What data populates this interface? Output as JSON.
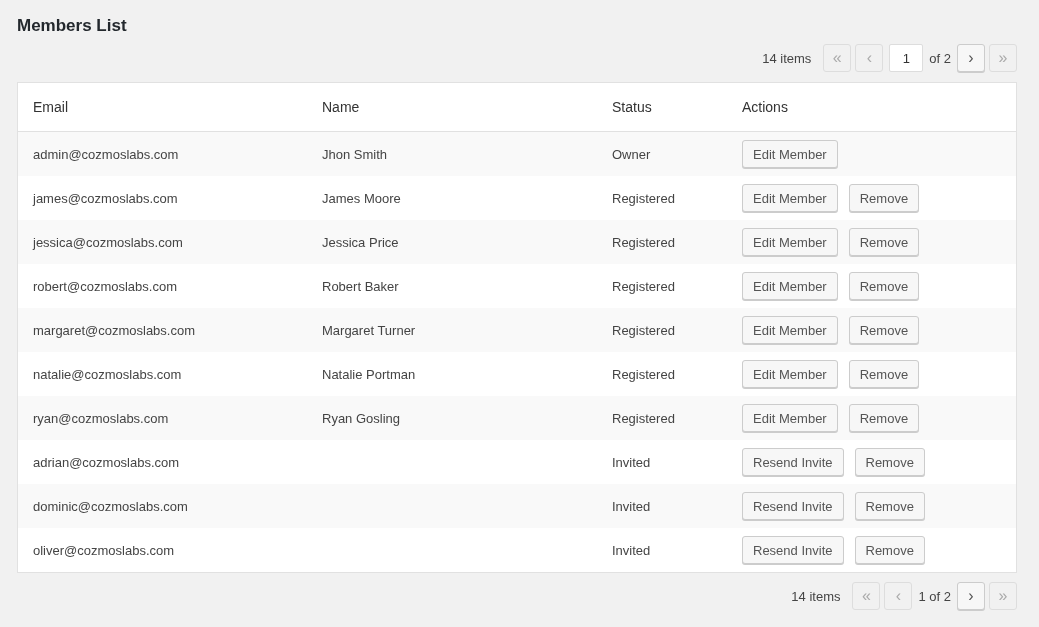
{
  "title": "Members List",
  "pagination_top": {
    "count": "14 items",
    "nav_before": [
      {
        "label": "«",
        "disabled": true
      },
      {
        "label": "‹",
        "disabled": true
      }
    ],
    "page_input": "1",
    "page_suffix": "of 2",
    "nav_after": [
      {
        "label": "›",
        "disabled": false
      },
      {
        "label": "»",
        "disabled": true
      }
    ]
  },
  "table": {
    "columns": [
      "Email",
      "Name",
      "Status",
      "Actions"
    ],
    "rows": [
      {
        "email": "admin@cozmoslabs.com",
        "name": "Jhon Smith",
        "status": "Owner",
        "actions": [
          "Edit Member"
        ]
      },
      {
        "email": "james@cozmoslabs.com",
        "name": "James Moore",
        "status": "Registered",
        "actions": [
          "Edit Member",
          "Remove"
        ]
      },
      {
        "email": "jessica@cozmoslabs.com",
        "name": "Jessica Price",
        "status": "Registered",
        "actions": [
          "Edit Member",
          "Remove"
        ]
      },
      {
        "email": "robert@cozmoslabs.com",
        "name": "Robert Baker",
        "status": "Registered",
        "actions": [
          "Edit Member",
          "Remove"
        ]
      },
      {
        "email": "margaret@cozmoslabs.com",
        "name": "Margaret Turner",
        "status": "Registered",
        "actions": [
          "Edit Member",
          "Remove"
        ]
      },
      {
        "email": "natalie@cozmoslabs.com",
        "name": "Natalie Portman",
        "status": "Registered",
        "actions": [
          "Edit Member",
          "Remove"
        ]
      },
      {
        "email": "ryan@cozmoslabs.com",
        "name": "Ryan Gosling",
        "status": "Registered",
        "actions": [
          "Edit Member",
          "Remove"
        ]
      },
      {
        "email": "adrian@cozmoslabs.com",
        "name": "",
        "status": "Invited",
        "actions": [
          "Resend Invite",
          "Remove"
        ]
      },
      {
        "email": "dominic@cozmoslabs.com",
        "name": "",
        "status": "Invited",
        "actions": [
          "Resend Invite",
          "Remove"
        ]
      },
      {
        "email": "oliver@cozmoslabs.com",
        "name": "",
        "status": "Invited",
        "actions": [
          "Resend Invite",
          "Remove"
        ]
      }
    ]
  },
  "pagination_bottom": {
    "count": "14 items",
    "nav_before": [
      {
        "label": "«",
        "disabled": true
      },
      {
        "label": "‹",
        "disabled": true
      }
    ],
    "page_text": "1 of 2",
    "nav_after": [
      {
        "label": "›",
        "disabled": false
      },
      {
        "label": "»",
        "disabled": true
      }
    ]
  }
}
